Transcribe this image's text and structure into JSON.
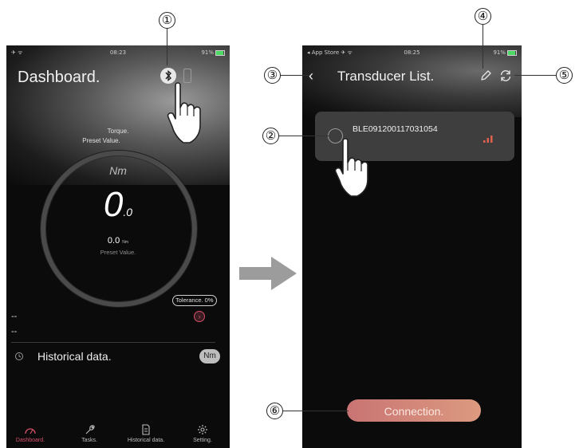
{
  "left_screen": {
    "status": {
      "time": "08:23",
      "battery": "91%"
    },
    "title": "Dashboard.",
    "gauge": {
      "torque_label": "Torque.",
      "preset_label": "Preset Value.",
      "unit": "Nm",
      "value_main": "0",
      "value_decimal": ".0",
      "preset_value": "0.0",
      "preset_unit": "Nm",
      "preset_caption": "Preset Value."
    },
    "tolerance_label": "Tolerance. 0%",
    "line1": "--",
    "line2": "--",
    "historical_label": "Historical data.",
    "unit_badge": "Nm",
    "tabs": [
      {
        "label": "Dashboard.",
        "icon": "gauge-icon",
        "active": true
      },
      {
        "label": "Tasks.",
        "icon": "wrench-icon",
        "active": false
      },
      {
        "label": "Historical data.",
        "icon": "document-icon",
        "active": false
      },
      {
        "label": "Setting.",
        "icon": "gear-icon",
        "active": false
      }
    ]
  },
  "right_screen": {
    "status": {
      "carrier": "◂ App Store",
      "time": "08:25",
      "battery": "91%"
    },
    "title": "Transducer List.",
    "device_name": "BLE091200117031054",
    "connect_label": "Connection."
  },
  "callouts": [
    "①",
    "②",
    "③",
    "④",
    "⑤",
    "⑥"
  ],
  "colors": {
    "accent_red": "#d6506a",
    "button_from": "#c97473",
    "button_to": "#dc9a80",
    "signal": "#e0604e",
    "background": "#0b0b0b"
  }
}
